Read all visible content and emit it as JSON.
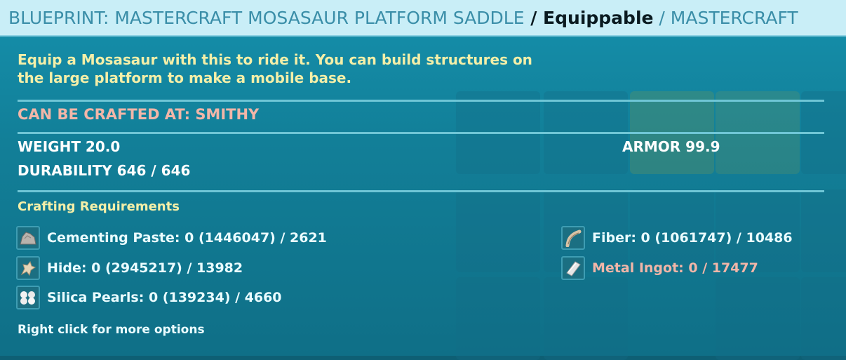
{
  "header": {
    "name": "BLUEPRINT: MASTERCRAFT MOSASAUR PLATFORM SADDLE",
    "sep1": " / ",
    "type": "Equippable",
    "sep2": " / ",
    "quality": "MASTERCRAFT"
  },
  "description": "Equip a Mosasaur with this to ride it.  You can build structures on the large platform to make a mobile base.",
  "crafted_at": "CAN BE CRAFTED AT: SMITHY",
  "stats": {
    "weight": "WEIGHT 20.0",
    "durability": "DURABILITY 646 / 646",
    "armor": "ARMOR 99.9"
  },
  "requirements": {
    "title": "Crafting Requirements",
    "items": [
      {
        "label": "Cementing Paste: 0 (1446047) / 2621",
        "icon": "cementing-paste-icon",
        "missing": false
      },
      {
        "label": "Hide: 0 (2945217) / 13982",
        "icon": "hide-icon",
        "missing": false
      },
      {
        "label": "Silica Pearls: 0 (139234) / 4660",
        "icon": "silica-pearls-icon",
        "missing": false
      },
      {
        "label": "Fiber: 0 (1061747) / 10486",
        "icon": "fiber-icon",
        "missing": false
      },
      {
        "label": "Metal Ingot: 0 / 17477",
        "icon": "metal-ingot-icon",
        "missing": true
      }
    ]
  },
  "footer": "Right click for more options",
  "colors": {
    "header_bg": "#c9eef7",
    "panel_bg": "#127f98",
    "description": "#f4efa8",
    "crafted_at": "#f2b6a8",
    "missing": "#f2b6a8"
  }
}
